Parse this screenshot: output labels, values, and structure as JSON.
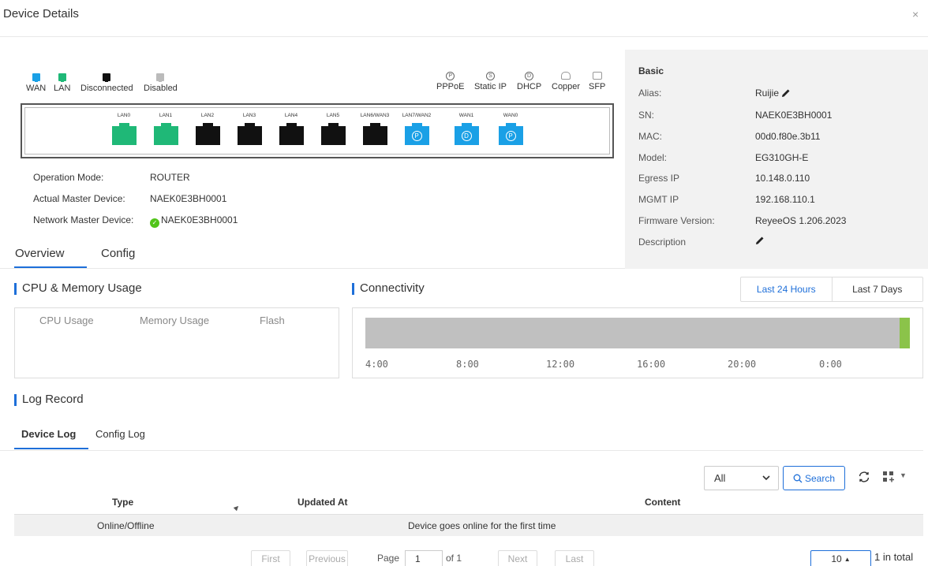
{
  "header": {
    "title": "Device Details",
    "close_label": "×"
  },
  "legend": {
    "status": [
      {
        "label": "WAN",
        "color": "#1aa0e6"
      },
      {
        "label": "LAN",
        "color": "#1fb877"
      },
      {
        "label": "Disconnected",
        "color": "#111111"
      },
      {
        "label": "Disabled",
        "color": "#bbbbbb"
      }
    ],
    "types": [
      {
        "glyph": "P",
        "label": "PPPoE"
      },
      {
        "glyph": "S",
        "label": "Static IP"
      },
      {
        "glyph": "D",
        "label": "DHCP"
      },
      {
        "glyph": "",
        "label": "Copper"
      },
      {
        "glyph": "",
        "label": "SFP"
      }
    ]
  },
  "ports": [
    {
      "label": "LAN0",
      "status": "lan",
      "type": ""
    },
    {
      "label": "LAN1",
      "status": "lan",
      "type": ""
    },
    {
      "label": "LAN2",
      "status": "disconnected",
      "type": ""
    },
    {
      "label": "LAN3",
      "status": "disconnected",
      "type": ""
    },
    {
      "label": "LAN4",
      "status": "disconnected",
      "type": ""
    },
    {
      "label": "LAN5",
      "status": "disconnected",
      "type": ""
    },
    {
      "label": "LAN6/WAN3",
      "status": "disconnected",
      "type": ""
    },
    {
      "label": "LAN7/WAN2",
      "status": "wan",
      "type": "P"
    },
    {
      "label": "WAN1",
      "status": "wan",
      "type": "D"
    },
    {
      "label": "WAN0",
      "status": "wan",
      "type": "P"
    }
  ],
  "info": {
    "operation_mode_label": "Operation Mode:",
    "operation_mode": "ROUTER",
    "actual_master_label": "Actual Master Device:",
    "actual_master": "NAEK0E3BH0001",
    "network_master_label": "Network Master Device:",
    "network_master": "NAEK0E3BH0001"
  },
  "tabs": {
    "overview": "Overview",
    "config": "Config"
  },
  "basic": {
    "title": "Basic",
    "alias_label": "Alias:",
    "alias": "Ruijie",
    "sn_label": "SN:",
    "sn": "NAEK0E3BH0001",
    "mac_label": "MAC:",
    "mac": "00d0.f80e.3b11",
    "model_label": "Model:",
    "model": "EG310GH-E",
    "egress_label": "Egress IP",
    "egress": "10.148.0.110",
    "mgmt_label": "MGMT IP",
    "mgmt": "192.168.110.1",
    "firmware_label": "Firmware Version:",
    "firmware": "ReyeeOS 1.206.2023",
    "description_label": "Description"
  },
  "usage": {
    "title": "CPU & Memory Usage",
    "cpu": "CPU Usage",
    "memory": "Memory Usage",
    "flash": "Flash"
  },
  "connectivity": {
    "title": "Connectivity",
    "range_24h": "Last 24 Hours",
    "range_7d": "Last 7 Days",
    "ticks": [
      "4:00",
      "8:00",
      "12:00",
      "16:00",
      "20:00",
      "0:00"
    ],
    "bar_color": "#c0c0c0",
    "online_color": "#8bc34a"
  },
  "log": {
    "title": "Log Record",
    "tab_device": "Device Log",
    "tab_config": "Config Log",
    "filter_value": "All",
    "search_label": "Search",
    "columns": [
      "Type",
      "Updated At",
      "Content"
    ],
    "rows": [
      {
        "type": "Online/Offline",
        "updated_at": "",
        "content": "Device goes online for the first time"
      }
    ]
  },
  "pagination": {
    "first": "First",
    "previous": "Previous",
    "page_label": "Page",
    "page": "1",
    "of": "of 1",
    "next": "Next",
    "last": "Last",
    "page_size": "10",
    "total": "1 in total"
  },
  "colors": {
    "accent": "#1e6fd9"
  }
}
